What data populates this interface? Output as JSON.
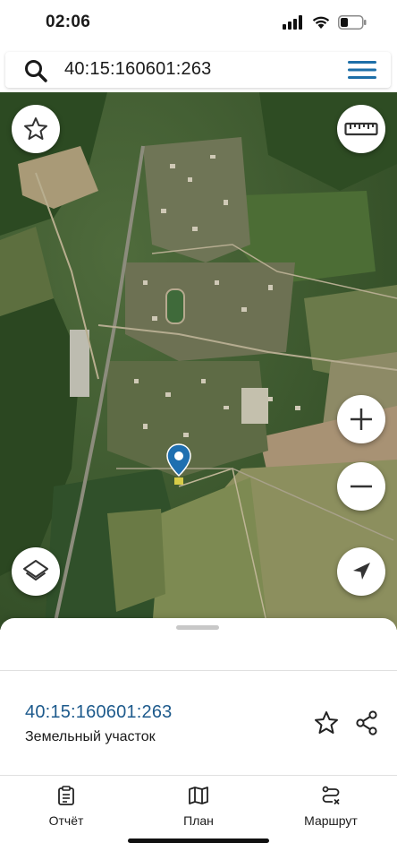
{
  "status_bar": {
    "time": "02:06",
    "icons": [
      "cellular-signal-icon",
      "wifi-icon",
      "battery-icon"
    ]
  },
  "search": {
    "value": "40:15:160601:263",
    "icons": [
      "search-icon",
      "menu-icon"
    ]
  },
  "map": {
    "type": "satellite",
    "controls": [
      "favorite-icon",
      "ruler-icon",
      "zoom-in-icon",
      "zoom-out-icon",
      "layers-icon",
      "my-location-icon"
    ],
    "marker": "location-pin-icon"
  },
  "parcel": {
    "number": "40:15:160601:263",
    "type": "Земельный участок"
  },
  "tabs": [
    {
      "label": "Отчёт",
      "icon": "report-icon"
    },
    {
      "label": "План",
      "icon": "map-plan-icon"
    },
    {
      "label": "Маршрут",
      "icon": "route-icon"
    }
  ],
  "colors": {
    "accent": "#1d5a8c",
    "menu": "#1d6fa8",
    "pin": "#1f6fb0"
  }
}
